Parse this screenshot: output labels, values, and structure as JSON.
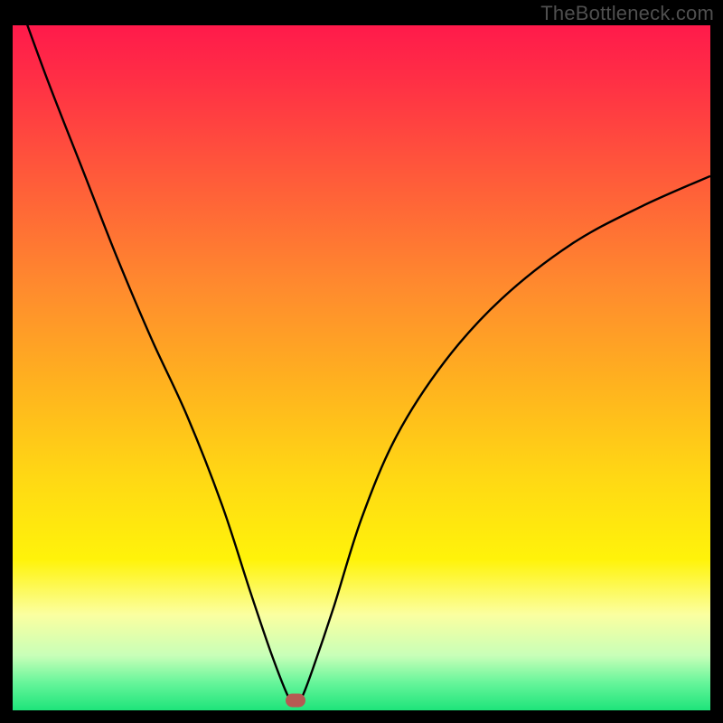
{
  "watermark": "TheBottleneck.com",
  "colors": {
    "frame": "#000000",
    "curve": "#000000",
    "marker": "#b55a53",
    "gradient_top": "#ff1a4b",
    "gradient_bottom": "#1ee47a"
  },
  "marker": {
    "x_frac": 0.405,
    "y_frac": 0.986
  },
  "chart_data": {
    "type": "line",
    "title": "",
    "xlabel": "",
    "ylabel": "",
    "xlim": [
      0,
      1
    ],
    "ylim": [
      0,
      1
    ],
    "note": "Axes are unlabeled; values are normalized plot-area fractions (0 = left/top in SVG space). y_value below is (1 - y_svg), i.e., higher = higher on the chart.",
    "series": [
      {
        "name": "curve",
        "x": [
          0.0,
          0.05,
          0.1,
          0.15,
          0.2,
          0.25,
          0.3,
          0.34,
          0.37,
          0.395,
          0.405,
          0.415,
          0.43,
          0.46,
          0.5,
          0.55,
          0.62,
          0.7,
          0.8,
          0.9,
          1.0
        ],
        "y_value": [
          1.06,
          0.92,
          0.79,
          0.66,
          0.54,
          0.43,
          0.3,
          0.175,
          0.085,
          0.02,
          0.01,
          0.02,
          0.06,
          0.15,
          0.28,
          0.4,
          0.51,
          0.6,
          0.68,
          0.735,
          0.78
        ]
      }
    ],
    "marker_point": {
      "x": 0.405,
      "y_value": 0.014
    }
  }
}
